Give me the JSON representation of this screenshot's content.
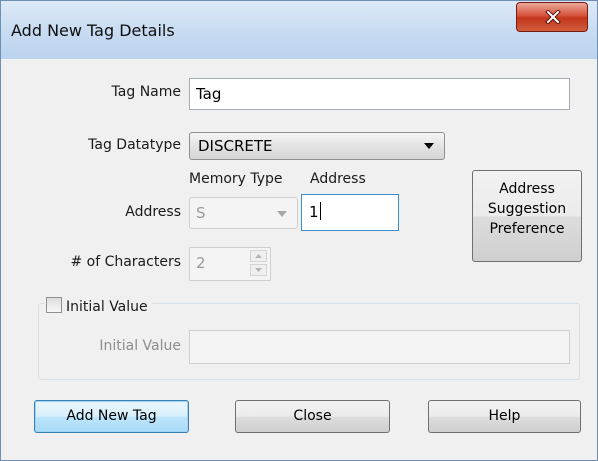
{
  "window": {
    "title": "Add New Tag Details",
    "close_icon": "close-icon"
  },
  "form": {
    "tag_name_label": "Tag Name",
    "tag_name_value": "Tag",
    "tag_datatype_label": "Tag Datatype",
    "tag_datatype_value": "DISCRETE",
    "memory_type_label": "Memory Type",
    "address_header_label": "Address",
    "address_label": "Address",
    "memory_type_value": "S",
    "address_value": "1",
    "address_suggestion_button": [
      "Address",
      "Suggestion",
      "Preference"
    ],
    "num_chars_label": "# of Characters",
    "num_chars_value": "2",
    "initial_value_checkbox_label": "Initial Value",
    "initial_value_checked": false,
    "initial_value_label": "Initial Value",
    "initial_value_value": ""
  },
  "buttons": {
    "add_new_tag": "Add New Tag",
    "close": "Close",
    "help": "Help"
  },
  "colors": {
    "accent": "#3c7fb1",
    "close_button": "#c2361d"
  }
}
